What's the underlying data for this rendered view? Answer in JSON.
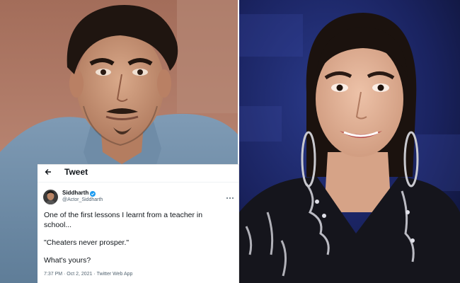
{
  "tweet": {
    "header_title": "Tweet",
    "author_name": "Siddharth",
    "author_handle": "@Actor_Siddharth",
    "body_line_1": "One of the first lessons I learnt from a teacher in",
    "body_line_2": "school...",
    "body_line_3": "\"Cheaters never prosper.\"",
    "body_line_4": "What's yours?",
    "meta": "7:37 PM · Oct 2, 2021 · Twitter Web App"
  },
  "icons": {
    "back": "back-arrow-icon",
    "verified": "verified-badge-icon",
    "more": "more-options-icon"
  },
  "colors": {
    "text": "#0f1419",
    "secondary": "#536471",
    "verified": "#1d9bf0"
  }
}
